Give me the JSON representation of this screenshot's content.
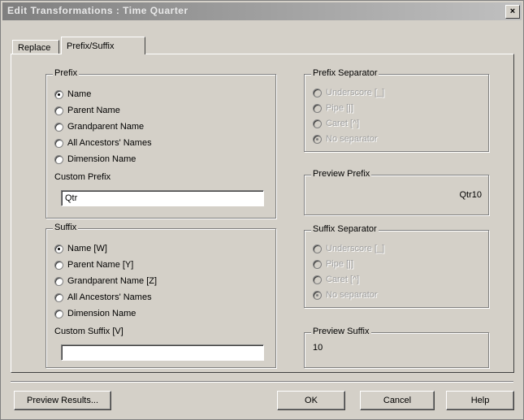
{
  "window": {
    "title": "Edit Transformations : Time Quarter",
    "close_glyph": "×"
  },
  "tabs": [
    {
      "label": "Replace"
    },
    {
      "label": "Prefix/Suffix"
    }
  ],
  "prefix": {
    "legend": "Prefix",
    "options": [
      "Name",
      "Parent Name",
      "Grandparent Name",
      "All Ancestors' Names",
      "Dimension Name"
    ],
    "selected_index": 0,
    "custom_label": "Custom Prefix",
    "custom_value": "Qtr"
  },
  "prefix_separator": {
    "legend": "Prefix Separator",
    "options": [
      "Underscore [_]",
      "Pipe [|]",
      "Caret [^]",
      "No separator"
    ],
    "selected_index": 3
  },
  "preview_prefix": {
    "legend": "Preview Prefix",
    "value": "Qtr10"
  },
  "suffix": {
    "legend": "Suffix",
    "options": [
      "Name [W]",
      "Parent Name [Y]",
      "Grandparent Name [Z]",
      "All Ancestors' Names",
      "Dimension Name"
    ],
    "selected_index": 0,
    "custom_label": "Custom Suffix [V]",
    "custom_value": ""
  },
  "suffix_separator": {
    "legend": "Suffix Separator",
    "options": [
      "Underscore [_]",
      "Pipe [|]",
      "Caret [^]",
      "No separator"
    ],
    "selected_index": 3
  },
  "preview_suffix": {
    "legend": "Preview Suffix",
    "value": "10"
  },
  "buttons": {
    "preview": "Preview Results...",
    "ok": "OK",
    "cancel": "Cancel",
    "help": "Help"
  }
}
